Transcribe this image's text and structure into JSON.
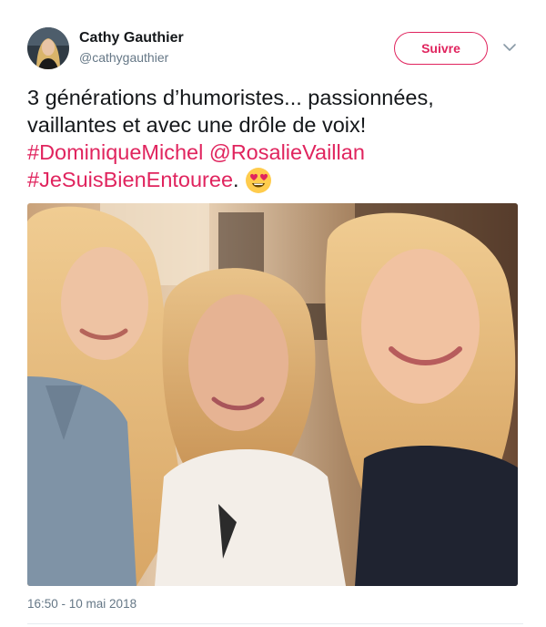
{
  "author": {
    "name": "Cathy Gauthier",
    "handle": "@cathygauthier"
  },
  "follow_button": {
    "label": "Suivre"
  },
  "menu_icon": "chevron-down-icon",
  "tweet": {
    "text_part1": "3 générations d’humoristes... passionnées, vaillantes et avec une drôle de voix!",
    "mention1": "#DominiqueMichel",
    "mention2": "@RosalieVaillan",
    "mention3": "#JeSuisBienEntouree",
    "punctuation": ".",
    "emoji": "heart-eyes-emoji"
  },
  "timestamp": "16:50 - 10 mai 2018",
  "colors": {
    "accent": "#e0245e",
    "text": "#14171a",
    "secondary": "#657786"
  }
}
